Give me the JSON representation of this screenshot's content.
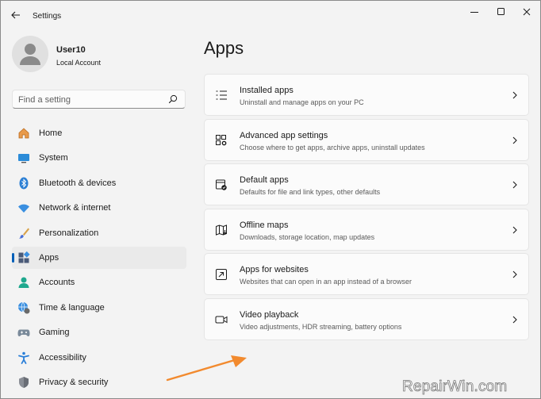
{
  "window": {
    "title": "Settings"
  },
  "profile": {
    "name": "User10",
    "account_type": "Local Account"
  },
  "search": {
    "placeholder": "Find a setting"
  },
  "sidebar": {
    "items": [
      {
        "label": "Home",
        "icon": "home-icon",
        "active": false
      },
      {
        "label": "System",
        "icon": "system-icon",
        "active": false
      },
      {
        "label": "Bluetooth & devices",
        "icon": "bluetooth-icon",
        "active": false
      },
      {
        "label": "Network & internet",
        "icon": "wifi-icon",
        "active": false
      },
      {
        "label": "Personalization",
        "icon": "brush-icon",
        "active": false
      },
      {
        "label": "Apps",
        "icon": "apps-icon",
        "active": true
      },
      {
        "label": "Accounts",
        "icon": "accounts-icon",
        "active": false
      },
      {
        "label": "Time & language",
        "icon": "globe-clock-icon",
        "active": false
      },
      {
        "label": "Gaming",
        "icon": "gamepad-icon",
        "active": false
      },
      {
        "label": "Accessibility",
        "icon": "accessibility-icon",
        "active": false
      },
      {
        "label": "Privacy & security",
        "icon": "shield-icon",
        "active": false
      }
    ]
  },
  "main": {
    "title": "Apps",
    "cards": [
      {
        "title": "Installed apps",
        "description": "Uninstall and manage apps on your PC",
        "icon": "list-icon"
      },
      {
        "title": "Advanced app settings",
        "description": "Choose where to get apps, archive apps, uninstall updates",
        "icon": "app-settings-icon"
      },
      {
        "title": "Default apps",
        "description": "Defaults for file and link types, other defaults",
        "icon": "default-apps-icon"
      },
      {
        "title": "Offline maps",
        "description": "Downloads, storage location, map updates",
        "icon": "map-icon"
      },
      {
        "title": "Apps for websites",
        "description": "Websites that can open in an app instead of a browser",
        "icon": "open-external-icon"
      },
      {
        "title": "Video playback",
        "description": "Video adjustments, HDR streaming, battery options",
        "icon": "video-icon"
      }
    ]
  },
  "colors": {
    "accent": "#005fb8",
    "annotation_arrow": "#f28a2e"
  },
  "watermark": {
    "text": "RepairWin.com"
  }
}
